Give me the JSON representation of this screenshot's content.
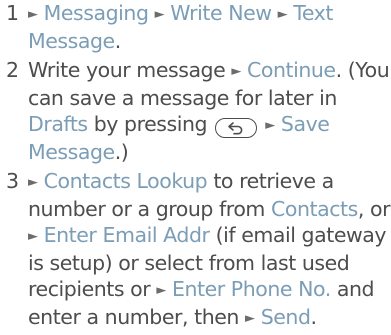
{
  "steps": [
    {
      "number": "1",
      "nav": [
        "Messaging",
        "Write New",
        "Text Message"
      ]
    },
    {
      "number": "2",
      "text_a": "Write your message",
      "continue": "Continue",
      "text_b": ". (You can save a message for later in",
      "drafts": "Drafts",
      "text_c": "by pressing",
      "back_key_icon": "back-key-icon",
      "save_message": "Save Message",
      "text_d": ".)"
    },
    {
      "number": "3",
      "contacts_lookup": "Contacts Lookup",
      "text_a": "to retrieve a number or a group from",
      "contacts": "Contacts",
      "text_b": ", or",
      "enter_email": "Enter Email Addr",
      "text_c": "(if email gateway is setup) or select from last used recipients or",
      "enter_phone": "Enter Phone No.",
      "text_d": "and enter a number, then",
      "send": "Send",
      "text_e": "."
    }
  ],
  "colors": {
    "text": "#4d4d4d",
    "link": "#7b9db6"
  }
}
